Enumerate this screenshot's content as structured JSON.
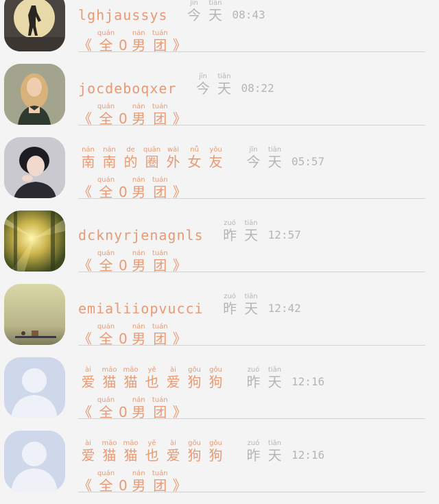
{
  "chats": [
    {
      "name_text": "lghjaussys",
      "name_ruby": [],
      "day": [
        {
          "py": "jīn",
          "hz": "今"
        },
        {
          "py": "tiān",
          "hz": "天"
        }
      ],
      "time": "08:43",
      "group_prefix": "《",
      "group": [
        {
          "py": "quán",
          "hz": "全"
        }
      ],
      "group_zero": "0",
      "group_rest": [
        {
          "py": "nán",
          "hz": "男"
        },
        {
          "py": "tuán",
          "hz": "团"
        }
      ],
      "group_suffix": "》",
      "avatar": "moon-silhouette"
    },
    {
      "name_text": "jocdeboqxer",
      "name_ruby": [],
      "day": [
        {
          "py": "jīn",
          "hz": "今"
        },
        {
          "py": "tiān",
          "hz": "天"
        }
      ],
      "time": "08:22",
      "group_prefix": "《",
      "group": [
        {
          "py": "quán",
          "hz": "全"
        }
      ],
      "group_zero": "0",
      "group_rest": [
        {
          "py": "nán",
          "hz": "男"
        },
        {
          "py": "tuán",
          "hz": "团"
        }
      ],
      "group_suffix": "》",
      "avatar": "blonde-woman"
    },
    {
      "name_text": "",
      "name_ruby": [
        {
          "py": "nán",
          "hz": "南"
        },
        {
          "py": "nán",
          "hz": "南"
        },
        {
          "py": "de",
          "hz": "的"
        },
        {
          "py": "quān",
          "hz": "圈"
        },
        {
          "py": "wài",
          "hz": "外"
        },
        {
          "py": "nǚ",
          "hz": "女"
        },
        {
          "py": "yǒu",
          "hz": "友"
        }
      ],
      "day": [
        {
          "py": "jīn",
          "hz": "今"
        },
        {
          "py": "tiān",
          "hz": "天"
        }
      ],
      "time": "05:57",
      "group_prefix": "《",
      "group": [
        {
          "py": "quán",
          "hz": "全"
        }
      ],
      "group_zero": "0",
      "group_rest": [
        {
          "py": "nán",
          "hz": "男"
        },
        {
          "py": "tuán",
          "hz": "团"
        }
      ],
      "group_suffix": "》",
      "avatar": "dark-hair-person"
    },
    {
      "name_text": "dcknyrjenagnls",
      "name_ruby": [],
      "day": [
        {
          "py": "zuó",
          "hz": "昨"
        },
        {
          "py": "tiān",
          "hz": "天"
        }
      ],
      "time": "12:57",
      "group_prefix": "《",
      "group": [
        {
          "py": "quán",
          "hz": "全"
        }
      ],
      "group_zero": "0",
      "group_rest": [
        {
          "py": "nán",
          "hz": "男"
        },
        {
          "py": "tuán",
          "hz": "团"
        }
      ],
      "group_suffix": "》",
      "avatar": "sunlit-forest"
    },
    {
      "name_text": "emialiiopvucci",
      "name_ruby": [],
      "day": [
        {
          "py": "zuó",
          "hz": "昨"
        },
        {
          "py": "tiān",
          "hz": "天"
        }
      ],
      "time": "12:42",
      "group_prefix": "《",
      "group": [
        {
          "py": "quán",
          "hz": "全"
        }
      ],
      "group_zero": "0",
      "group_rest": [
        {
          "py": "nán",
          "hz": "男"
        },
        {
          "py": "tuán",
          "hz": "团"
        }
      ],
      "group_suffix": "》",
      "avatar": "hazy-landscape"
    },
    {
      "name_text": "",
      "name_ruby": [
        {
          "py": "ài",
          "hz": "爱"
        },
        {
          "py": "māo",
          "hz": "猫"
        },
        {
          "py": "māo",
          "hz": "猫"
        },
        {
          "py": "yě",
          "hz": "也"
        },
        {
          "py": "ài",
          "hz": "爱"
        },
        {
          "py": "gǒu",
          "hz": "狗"
        },
        {
          "py": "gǒu",
          "hz": "狗"
        }
      ],
      "day": [
        {
          "py": "zuó",
          "hz": "昨"
        },
        {
          "py": "tiān",
          "hz": "天"
        }
      ],
      "time": "12:16",
      "group_prefix": "《",
      "group": [
        {
          "py": "quán",
          "hz": "全"
        }
      ],
      "group_zero": "0",
      "group_rest": [
        {
          "py": "nán",
          "hz": "男"
        },
        {
          "py": "tuán",
          "hz": "团"
        }
      ],
      "group_suffix": "》",
      "avatar": "default-avatar"
    },
    {
      "name_text": "",
      "name_ruby": [
        {
          "py": "ài",
          "hz": "爱"
        },
        {
          "py": "māo",
          "hz": "猫"
        },
        {
          "py": "māo",
          "hz": "猫"
        },
        {
          "py": "yě",
          "hz": "也"
        },
        {
          "py": "ài",
          "hz": "爱"
        },
        {
          "py": "gǒu",
          "hz": "狗"
        },
        {
          "py": "gǒu",
          "hz": "狗"
        }
      ],
      "day": [
        {
          "py": "zuó",
          "hz": "昨"
        },
        {
          "py": "tiān",
          "hz": "天"
        }
      ],
      "time": "12:16",
      "group_prefix": "《",
      "group": [
        {
          "py": "quán",
          "hz": "全"
        }
      ],
      "group_zero": "0",
      "group_rest": [
        {
          "py": "nán",
          "hz": "男"
        },
        {
          "py": "tuán",
          "hz": "团"
        }
      ],
      "group_suffix": "》",
      "avatar": "default-avatar"
    }
  ],
  "colors": {
    "accent": "#e79a73",
    "muted": "#b5b5b5",
    "divider": "#d2d2d2",
    "background": "#f4f4f4"
  }
}
